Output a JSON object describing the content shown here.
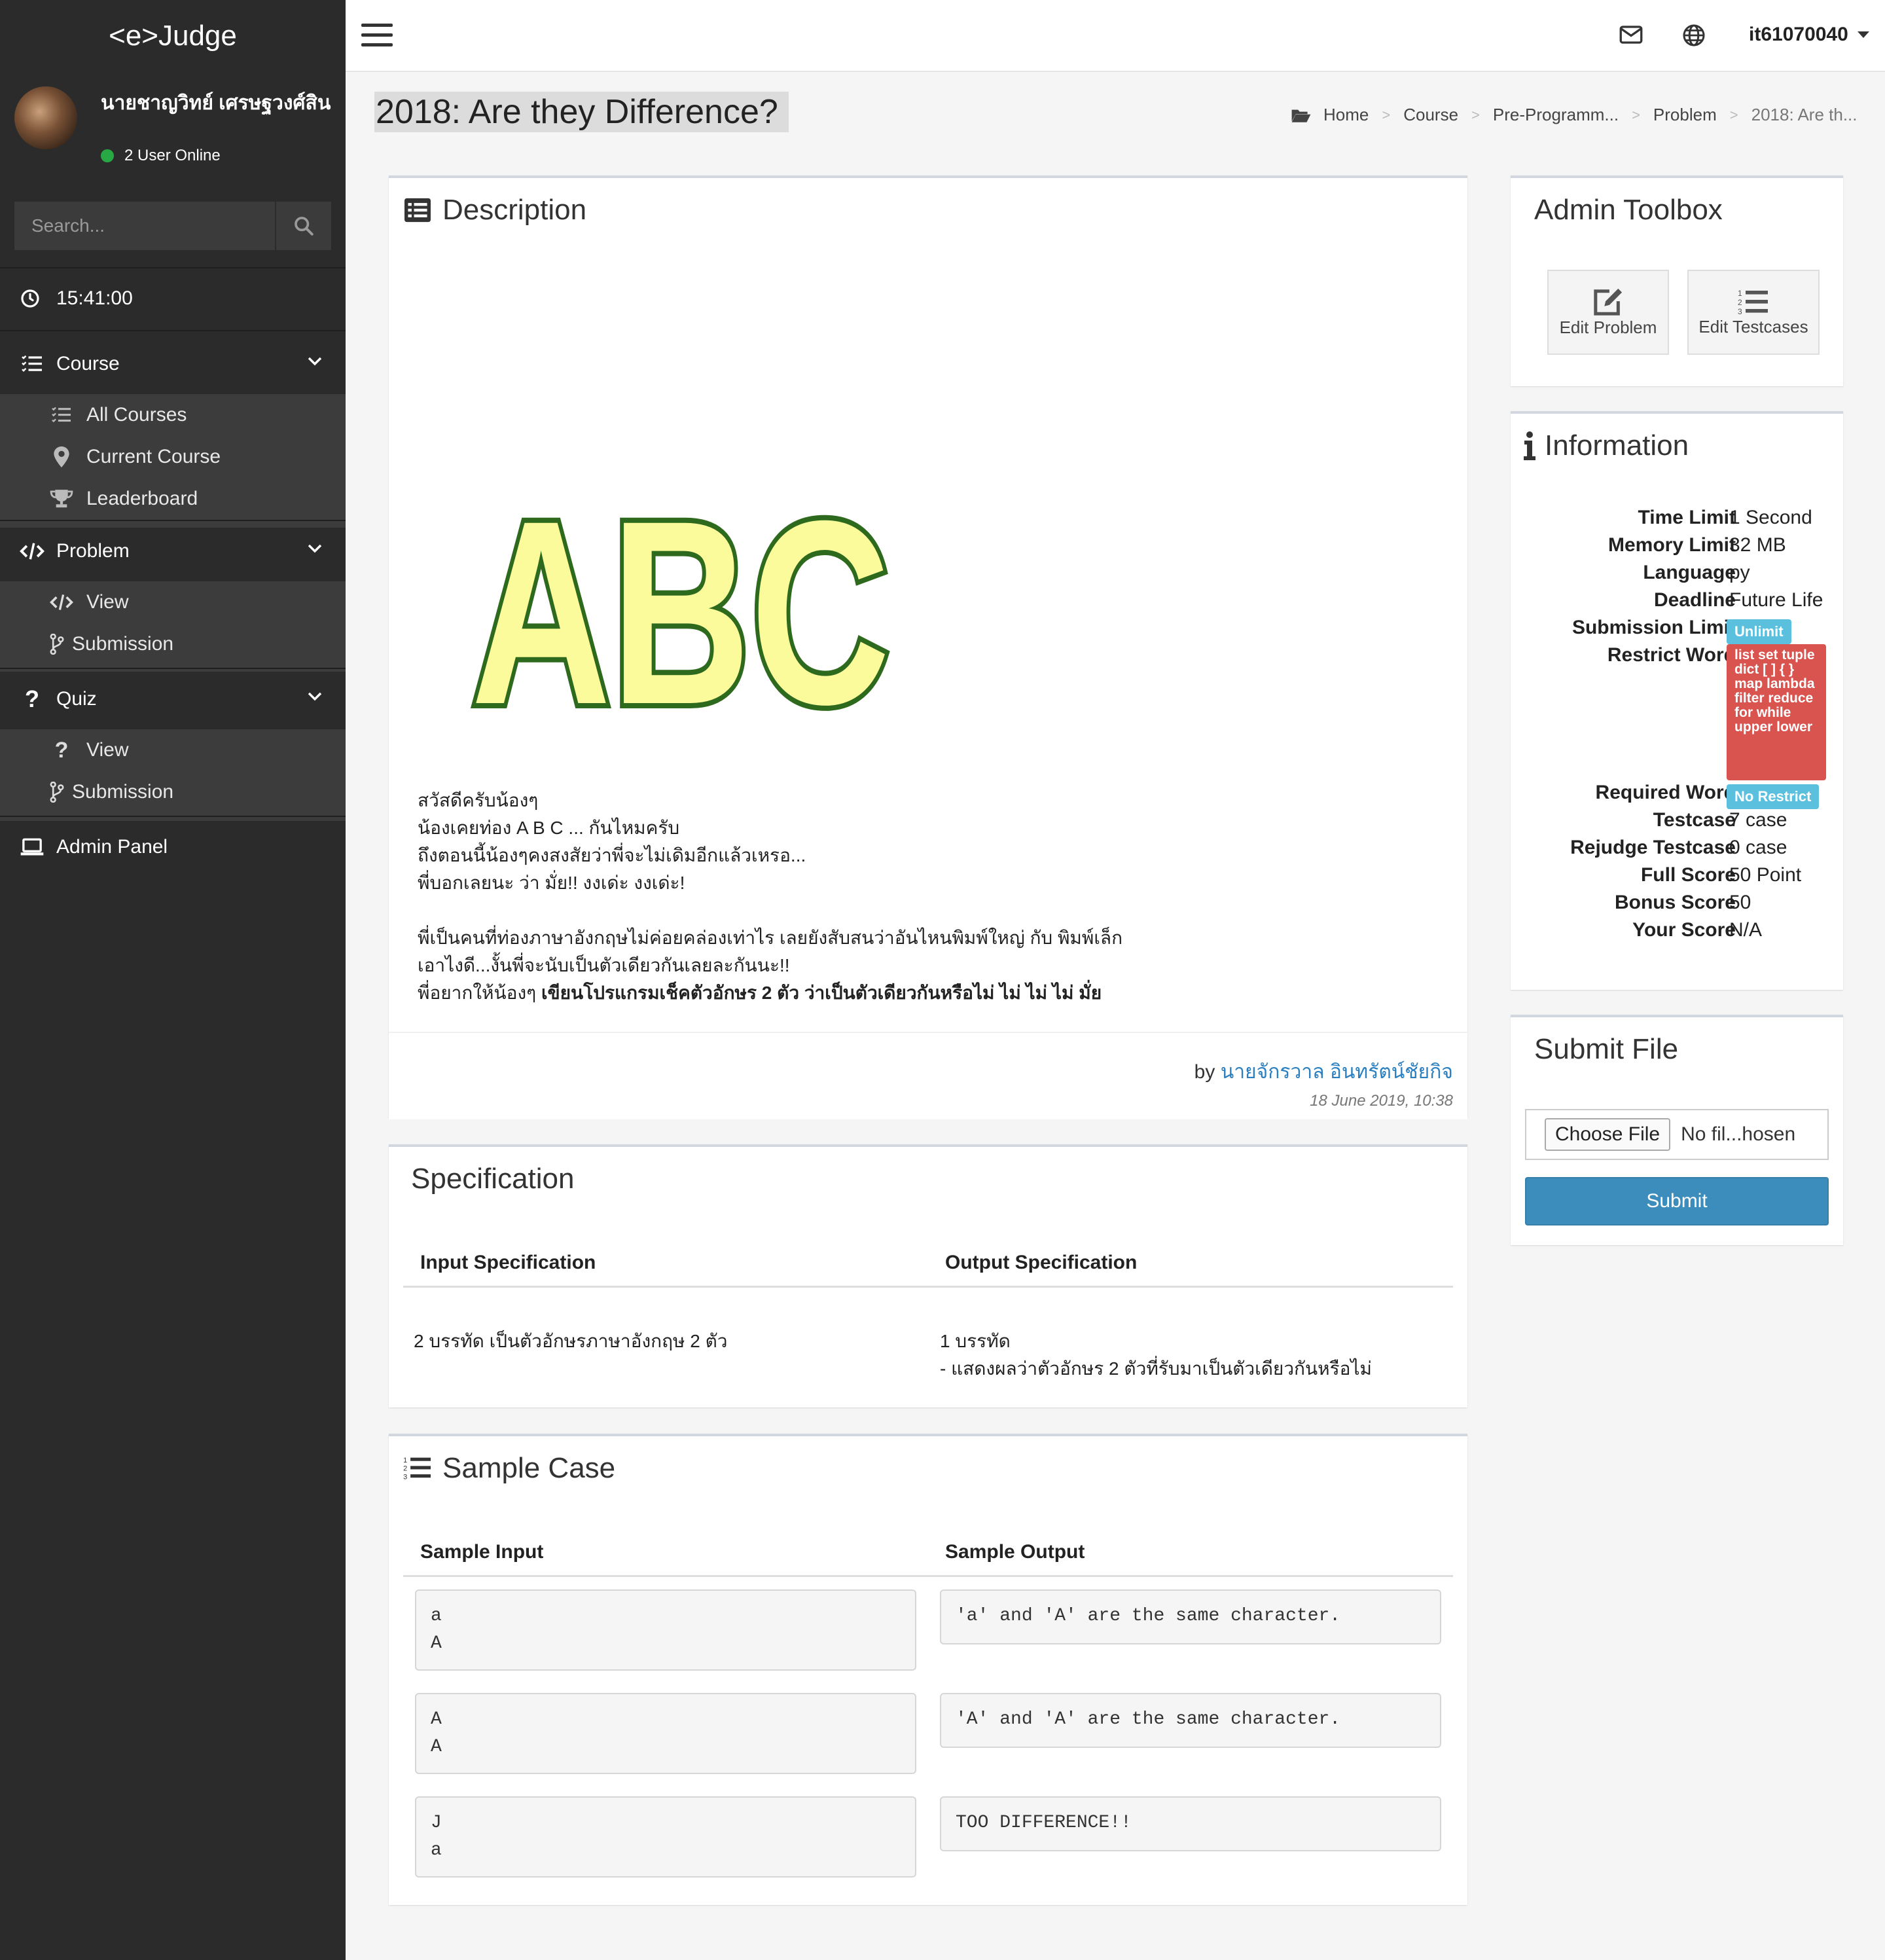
{
  "app": {
    "logo": "<e>Judge"
  },
  "user": {
    "name": "นายชาญวิทย์ เศรษฐวงศ์สิน",
    "online": "2 User Online"
  },
  "search": {
    "placeholder": "Search..."
  },
  "clock": "15:41:00",
  "sidebar": {
    "course": {
      "label": "Course",
      "items": [
        "All Courses",
        "Current Course",
        "Leaderboard"
      ]
    },
    "problem": {
      "label": "Problem",
      "items": [
        "View",
        "Submission"
      ]
    },
    "quiz": {
      "label": "Quiz",
      "items": [
        "View",
        "Submission"
      ]
    },
    "admin": "Admin Panel"
  },
  "topbar": {
    "username": "it61070040"
  },
  "page": {
    "title": "2018: Are they Difference?",
    "breadcrumb": [
      "Home",
      "Course",
      "Pre-Programm...",
      "Problem",
      "2018: Are th..."
    ]
  },
  "description": {
    "title": "Description",
    "image_text": "ABC",
    "lines": [
      "สวัสดีครับน้องๆ",
      "น้องเคยท่อง A B C ... กันไหมครับ",
      "ถึงตอนนี้น้องๆคงสงสัยว่าพี่จะไม่เดิมอีกแล้วเหรอ...",
      "พี่บอกเลยนะ ว่า มั่ย!! งงเด่ะ งงเด่ะ!",
      "พี่เป็นคนที่ท่องภาษาอังกฤษไม่ค่อยคล่องเท่าไร เลยยังสับสนว่าอันไหนพิมพ์ใหญ่ กับ พิมพ์เล็ก",
      "เอาไงดี...งั้นพี่จะนับเป็นตัวเดียวกันเลยละกันนะ!!"
    ],
    "last_line_prefix": "พี่อยากให้น้องๆ ",
    "last_line_bold": "เขียนโปรแกรมเช็คตัวอักษร 2 ตัว ว่าเป็นตัวเดียวกันหรือไม่ ไม่ ไม่ ไม่ มั่ย",
    "by": "by",
    "author": "นายจักรวาล อินทรัตน์ชัยกิจ",
    "date": "18 June 2019, 10:38"
  },
  "specification": {
    "title": "Specification",
    "input_header": "Input Specification",
    "output_header": "Output Specification",
    "input": "2 บรรทัด เป็นตัวอักษรภาษาอังกฤษ 2 ตัว",
    "output_line1": "1 บรรทัด",
    "output_line2": "- แสดงผลว่าตัวอักษร 2 ตัวที่รับมาเป็นตัวเดียวกันหรือไม่"
  },
  "sample": {
    "title": "Sample Case",
    "input_header": "Sample Input",
    "output_header": "Sample Output",
    "cases": [
      {
        "input": "a\nA",
        "output": "'a' and 'A' are the same character."
      },
      {
        "input": "A\nA",
        "output": "'A' and 'A' are the same character."
      },
      {
        "input": "J\na",
        "output": "TOO DIFFERENCE!!"
      }
    ]
  },
  "toolbox": {
    "title": "Admin Toolbox",
    "edit_problem": "Edit Problem",
    "edit_testcases": "Edit Testcases"
  },
  "information": {
    "title": "Information",
    "time_limit": {
      "label": "Time Limit",
      "value": "1 Second"
    },
    "memory_limit": {
      "label": "Memory Limit",
      "value": "32 MB"
    },
    "language": {
      "label": "Language",
      "value": "py"
    },
    "deadline": {
      "label": "Deadline",
      "value": "Future Life"
    },
    "submission_limit": {
      "label": "Submission Limit",
      "value": "Unlimit"
    },
    "restrict_word": {
      "label": "Restrict Word",
      "value": "list set tuple dict [ ] { } map lambda filter reduce for while upper lower"
    },
    "required_word": {
      "label": "Required Word",
      "value": "No Restrict"
    },
    "testcase": {
      "label": "Testcase",
      "value": "7 case"
    },
    "rejudge_testcase": {
      "label": "Rejudge Testcase",
      "value": "0 case"
    },
    "full_score": {
      "label": "Full Score",
      "value": "50 Point"
    },
    "bonus_score": {
      "label": "Bonus Score",
      "value": "50"
    },
    "your_score": {
      "label": "Your Score",
      "value": "N/A"
    }
  },
  "submit": {
    "title": "Submit File",
    "choose_file": "Choose File",
    "file_name": "No fil...hosen",
    "button": "Submit"
  },
  "colors": {
    "sidebar": "#2b2b2b",
    "submenu": "#3c3c3c",
    "primary": "#3c8dbc",
    "info_badge": "#5bc0de",
    "danger_badge": "#d9534f",
    "online": "#28a745",
    "link": "#2a7fc0"
  }
}
